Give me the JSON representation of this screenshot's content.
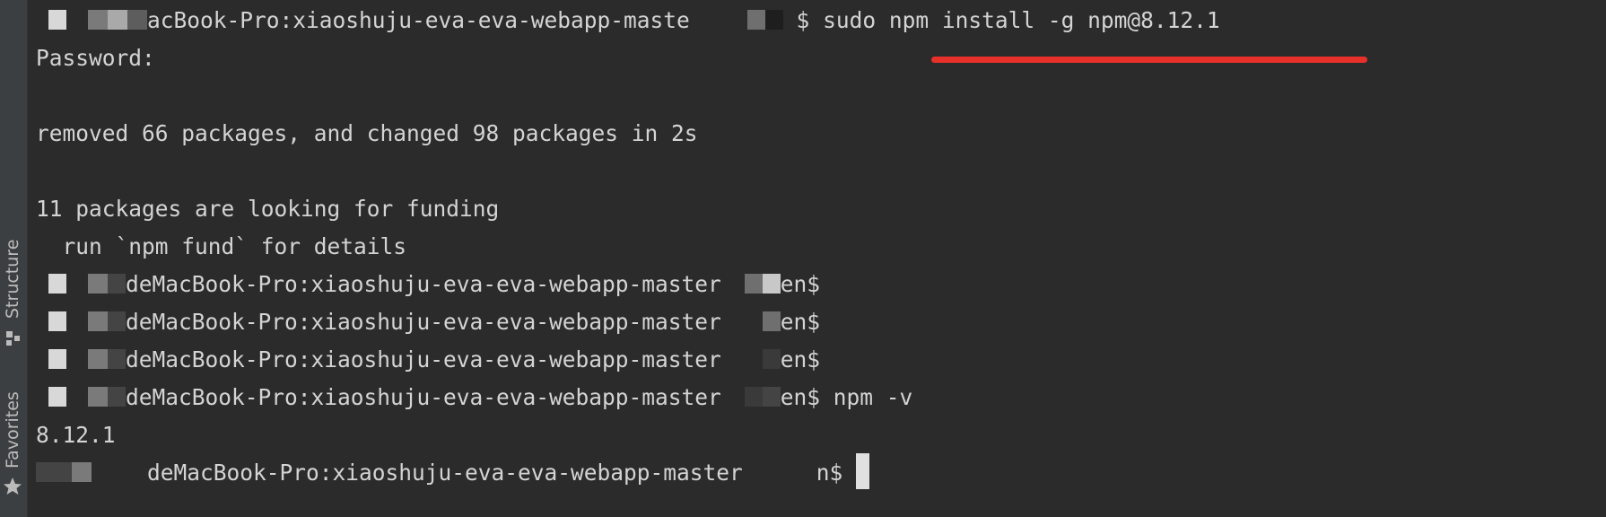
{
  "sidebar": {
    "structure_label": "Structure",
    "favorites_label": "Favorites"
  },
  "terminal": {
    "line1": {
      "prompt_host": "acBook-Pro:xiaoshuju-eva-eva-webapp-maste",
      "prompt_symbol": "$",
      "command": "sudo npm install -g npm@8.12.1"
    },
    "line2": "Password:",
    "line4": "removed 66 packages, and changed 98 packages in 2s",
    "line6": "11 packages are looking for funding",
    "line7": "  run `npm fund` for details",
    "prompt_host_full": "deMacBook-Pro:xiaoshuju-eva-eva-webapp-master",
    "prompt_end": "en$",
    "line11_command": "npm -v",
    "line12": "8.12.1",
    "last_prompt_end": "n$"
  },
  "colors": {
    "background": "#2b2b2b",
    "text": "#d4d4d4",
    "underline": "#e8302a"
  }
}
